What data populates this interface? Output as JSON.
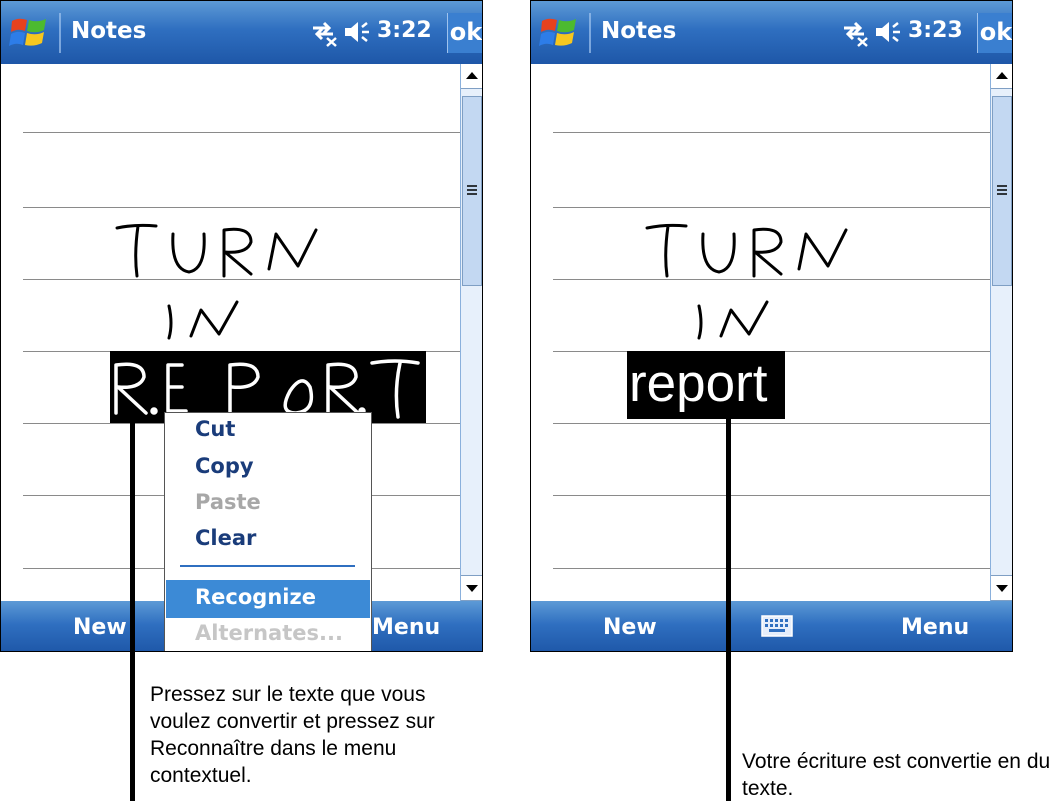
{
  "screens": [
    {
      "title": "Notes",
      "time": "3:22",
      "ok_label": "ok",
      "bottom_left": "New",
      "bottom_right": "Menu",
      "handwriting": [
        "TURN",
        "IN",
        "REPORT"
      ],
      "context_menu": {
        "items": [
          {
            "label": "Cut",
            "enabled": true
          },
          {
            "label": "Copy",
            "enabled": true
          },
          {
            "label": "Paste",
            "enabled": false
          },
          {
            "label": "Clear",
            "enabled": true
          },
          {
            "label": "Recognize",
            "enabled": true,
            "highlighted": true
          },
          {
            "label": "Alternates...",
            "enabled": false
          }
        ]
      }
    },
    {
      "title": "Notes",
      "time": "3:23",
      "ok_label": "ok",
      "bottom_left": "New",
      "bottom_right": "Menu",
      "bottom_center_icon": "keyboard-icon",
      "handwriting": [
        "TURN",
        "IN"
      ],
      "recognized_text": "report"
    }
  ],
  "captions": {
    "left": "Pressez sur le texte que vous voulez convertir et pressez sur Reconnaître dans le menu contextuel.",
    "right": "Votre écriture est convertie en du texte."
  },
  "colors": {
    "bar_blue": "#2f6fc0",
    "menu_text": "#1a3c7a",
    "highlight": "#3c8ad6",
    "disabled": "#a7a7a7"
  }
}
